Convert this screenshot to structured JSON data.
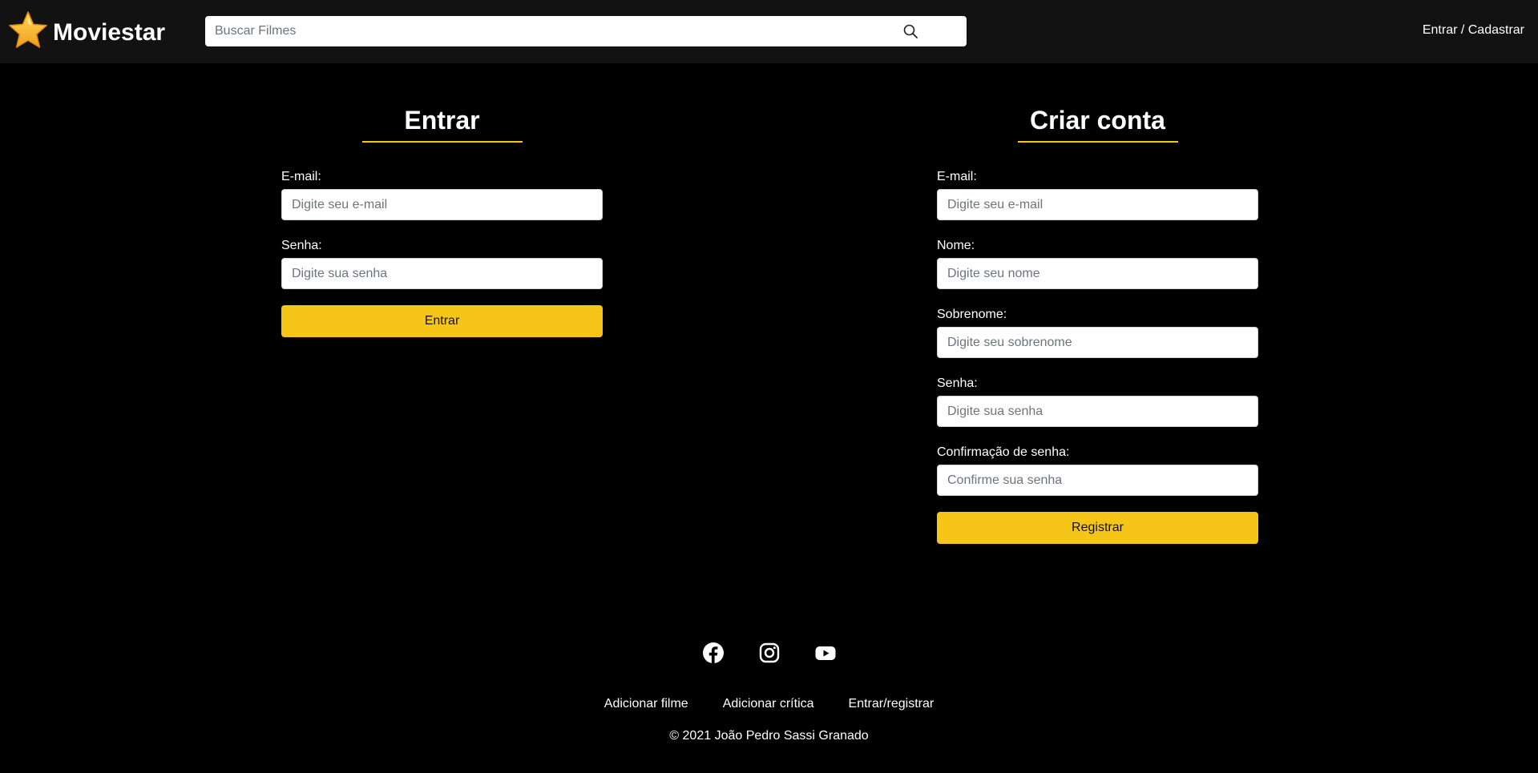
{
  "header": {
    "brand": "Moviestar",
    "search": {
      "placeholder": "Buscar Filmes",
      "value": ""
    },
    "auth_link": "Entrar / Cadastrar"
  },
  "login": {
    "title": "Entrar",
    "fields": [
      {
        "label": "E-mail:",
        "placeholder": "Digite seu e-mail",
        "value": ""
      },
      {
        "label": "Senha:",
        "placeholder": "Digite sua senha",
        "value": ""
      }
    ],
    "submit": "Entrar"
  },
  "register": {
    "title": "Criar conta",
    "fields": [
      {
        "label": "E-mail:",
        "placeholder": "Digite seu e-mail",
        "value": ""
      },
      {
        "label": "Nome:",
        "placeholder": "Digite seu nome",
        "value": ""
      },
      {
        "label": "Sobrenome:",
        "placeholder": "Digite seu sobrenome",
        "value": ""
      },
      {
        "label": "Senha:",
        "placeholder": "Digite sua senha",
        "value": ""
      },
      {
        "label": "Confirmação de senha:",
        "placeholder": "Confirme sua senha",
        "value": ""
      }
    ],
    "submit": "Registrar"
  },
  "footer": {
    "social": [
      "facebook-icon",
      "instagram-icon",
      "youtube-icon"
    ],
    "links": [
      "Adicionar filme",
      "Adicionar crítica",
      "Entrar/registrar"
    ],
    "copyright": "© 2021 João Pedro Sassi Granado"
  },
  "colors": {
    "accent": "#f5c518",
    "header_bg": "#121212",
    "page_bg": "#000000",
    "text": "#ffffff"
  }
}
